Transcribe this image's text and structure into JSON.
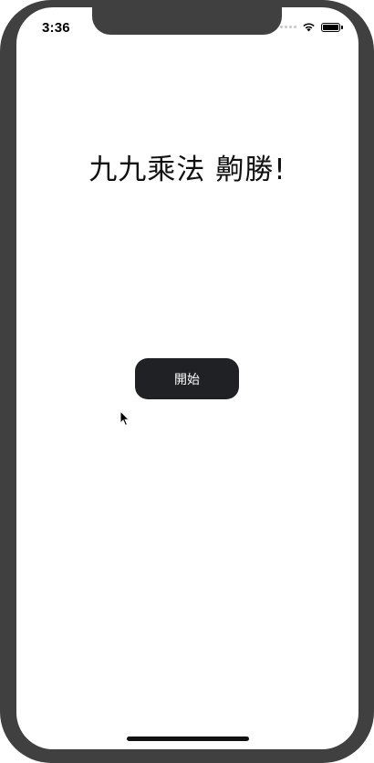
{
  "status_bar": {
    "time": "3:36"
  },
  "main": {
    "title": "九九乘法 齁勝!",
    "start_button_label": "開始"
  },
  "colors": {
    "device_frame": "#404040",
    "button_background": "#202124",
    "button_text": "#ffffff",
    "background": "#ffffff"
  },
  "icons": [
    "wifi-icon",
    "battery-icon",
    "signal-icon",
    "mouse-cursor-icon"
  ]
}
